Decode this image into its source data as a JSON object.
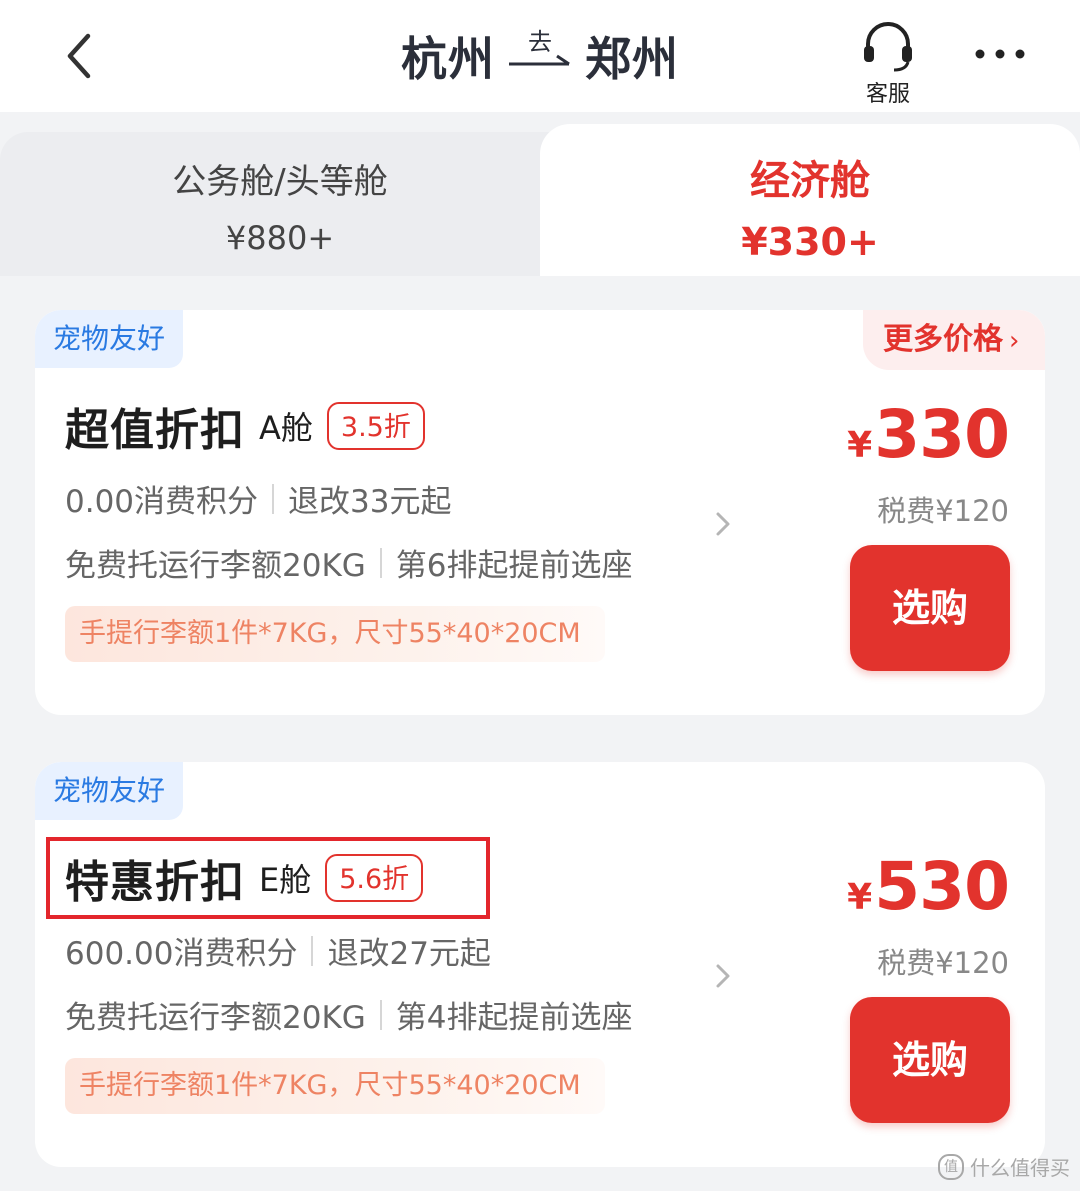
{
  "header": {
    "from_city": "杭州",
    "go_label": "去",
    "to_city": "郑州",
    "service_label": "客服",
    "icons": {
      "back": "chevron-left-icon",
      "service": "headset-icon",
      "more": "more-dots-icon"
    }
  },
  "tabs": [
    {
      "name": "公务舱/头等舱",
      "price": "¥880+",
      "selected": false
    },
    {
      "name": "经济舱",
      "price": "¥330+",
      "selected": true
    }
  ],
  "offers": [
    {
      "pet_badge": "宠物友好",
      "more_prices": "更多价格",
      "fare_name": "超值折扣",
      "cabin": "A舱",
      "discount": "3.5折",
      "points": "0.00消费积分",
      "refund": "退改33元起",
      "baggage": "免费托运行李额20KG",
      "seat": "第6排起提前选座",
      "carry_on": "手提行李额1件*7KG，尺寸55*40*20CM",
      "currency": "¥",
      "price": "330",
      "tax": "税费¥120",
      "buy_label": "选购"
    },
    {
      "pet_badge": "宠物友好",
      "fare_name": "特惠折扣",
      "cabin": "E舱",
      "discount": "5.6折",
      "points": "600.00消费积分",
      "refund": "退改27元起",
      "baggage": "免费托运行李额20KG",
      "seat": "第4排起提前选座",
      "carry_on": "手提行李额1件*7KG，尺寸55*40*20CM",
      "currency": "¥",
      "price": "530",
      "tax": "税费¥120",
      "buy_label": "选购"
    }
  ],
  "watermark": {
    "icon": "值",
    "text": "什么值得买"
  },
  "colors": {
    "accent": "#e2332d",
    "pet_badge_text": "#2a7ae2",
    "highlight_box": "#e3262c"
  }
}
